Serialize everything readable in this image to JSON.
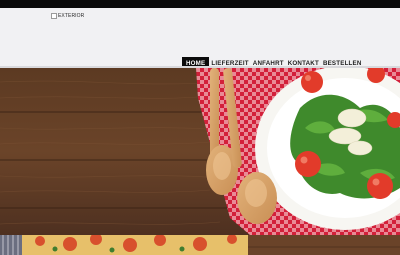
{
  "logo": {
    "alt_text": "EXTERIOR"
  },
  "nav": {
    "items": [
      {
        "label": "HOME",
        "active": true
      },
      {
        "label": "LIEFERZEIT",
        "active": false
      },
      {
        "label": "ANFAHRT",
        "active": false
      },
      {
        "label": "KONTAKT",
        "active": false
      },
      {
        "label": "BESTELLEN",
        "active": false
      }
    ]
  },
  "colors": {
    "top_bar": "#0a0a0a",
    "header_bg": "#f1f1f3",
    "nav_active_bg": "#0b0b0b",
    "nav_active_text": "#ffffff",
    "nav_text": "#1e1e1e"
  },
  "hero": {
    "icon": "food-hero-image"
  },
  "teaser": {
    "icon": "pizza-image"
  }
}
